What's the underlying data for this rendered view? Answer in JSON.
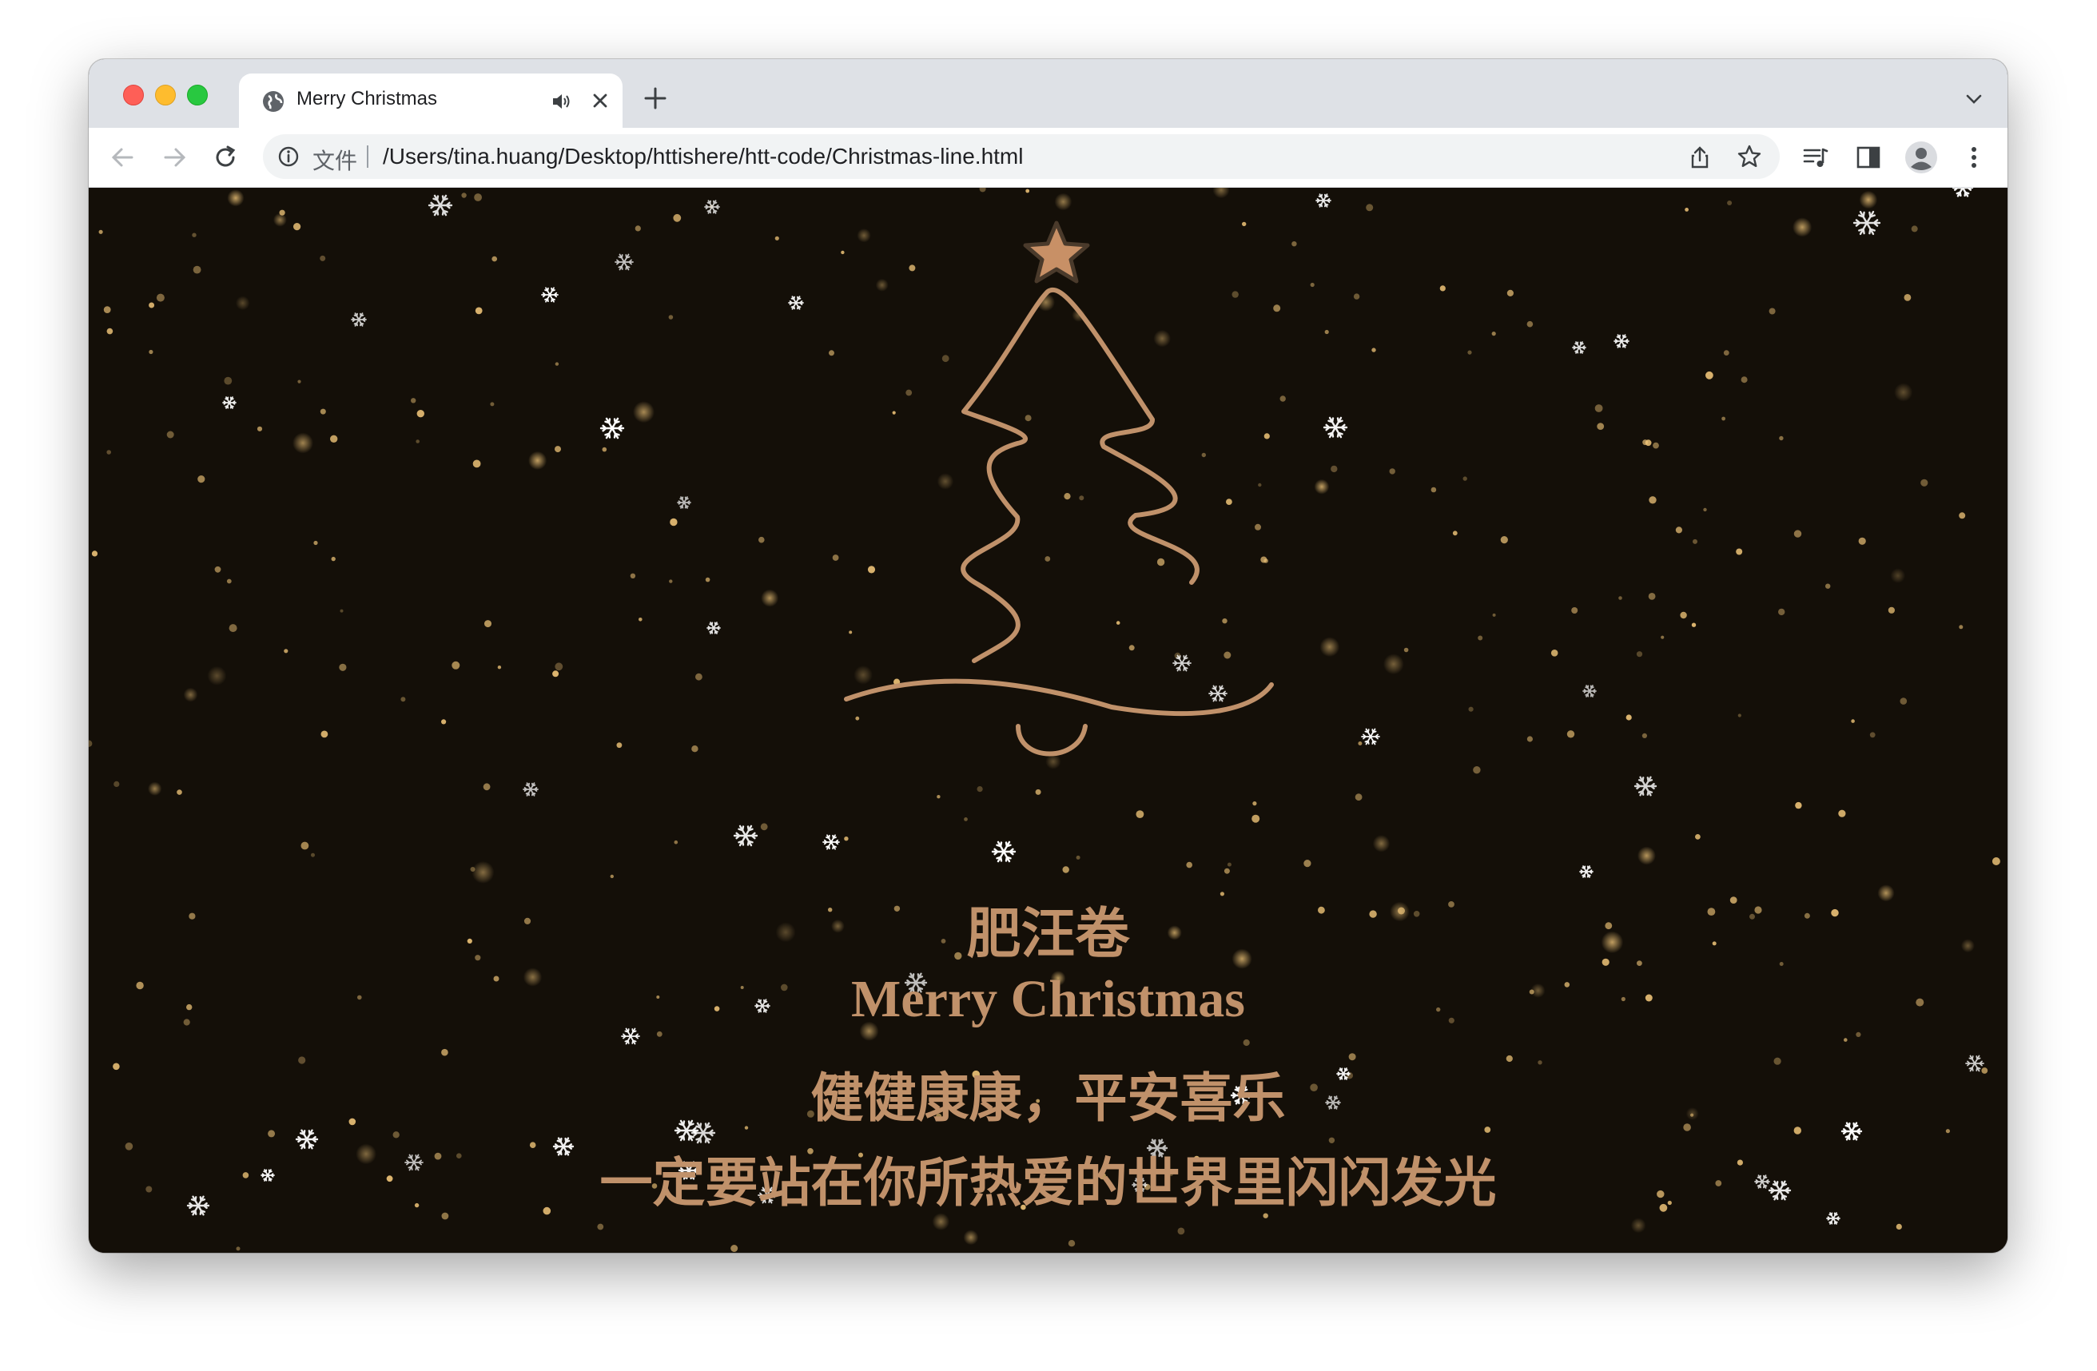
{
  "browser": {
    "tab_title": "Merry Christmas",
    "address_scheme_label": "文件",
    "address_url": "/Users/tina.huang/Desktop/httishere/htt-code/Christmas-line.html",
    "icons": [
      "globe-icon",
      "speaker-icon",
      "close-icon",
      "plus-icon",
      "chevron-down-icon",
      "back-arrow-icon",
      "forward-arrow-icon",
      "reload-icon",
      "info-icon",
      "share-icon",
      "star-icon",
      "media-control-icon",
      "side-panel-icon",
      "profile-icon",
      "menu-dots-icon"
    ]
  },
  "page": {
    "name_line": "肥汪卷",
    "merry_line": "Merry Christmas",
    "wish_line_1": "健健康康，平安喜乐",
    "wish_line_2": "一定要站在你所热爱的世界里闪闪发光"
  },
  "colors": {
    "background": "#140f08",
    "accent": "#c0916a",
    "snow": "#ffffff",
    "sparkle": "#f2c77a"
  }
}
